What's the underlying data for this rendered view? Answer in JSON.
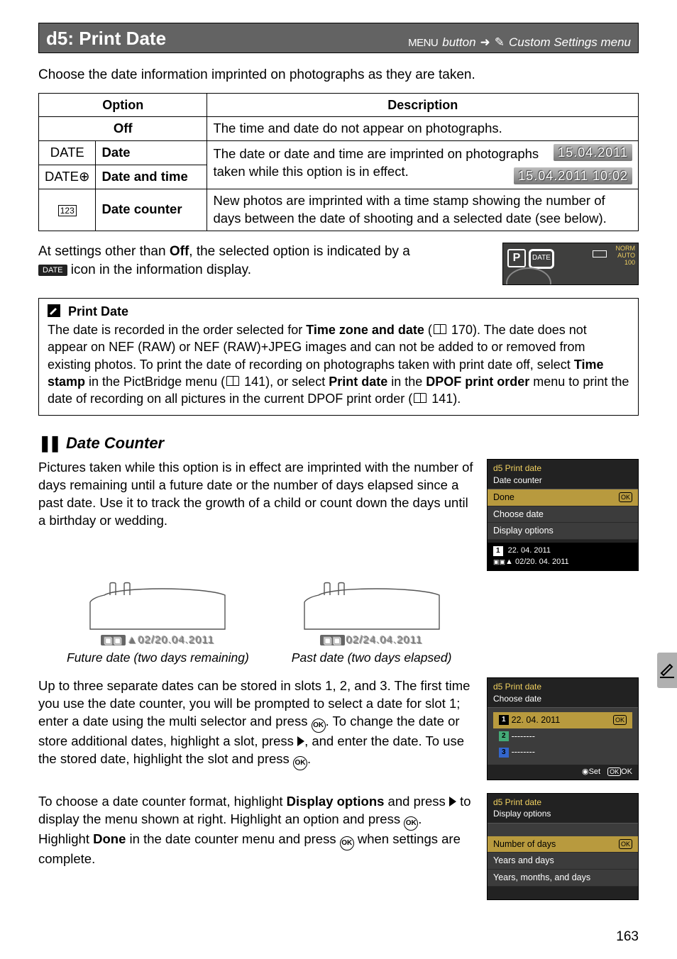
{
  "header": {
    "title": "d5: Print Date",
    "menu_label": "MENU",
    "button_text": "button",
    "arrow": "➜",
    "pencil": "✎",
    "crumb": "Custom Settings menu"
  },
  "intro": "Choose the date information imprinted on photographs as they are taken.",
  "table": {
    "col_option": "Option",
    "col_desc": "Description",
    "rows": {
      "off": {
        "icon": "",
        "label": "Off",
        "desc": "The time and date do not appear on photographs."
      },
      "date": {
        "icon": "DATE",
        "label": "Date",
        "desc": "The date or date and time are imprinted on photographs taken while this option is in effect.",
        "badge": "15.04.2011"
      },
      "datetime": {
        "icon": "DATE⊕",
        "label": "Date and time",
        "badge": "15.04.2011 10:02"
      },
      "counter": {
        "icon": "123",
        "label": "Date counter",
        "desc": "New photos are imprinted with a time stamp showing the number of days between the date of shooting and a selected date (see below)."
      }
    }
  },
  "post_table": {
    "l1a": "At settings other than ",
    "off": "Off",
    "l1b": ", the selected option is indicated by a ",
    "l2a": " icon in the information display.",
    "chip": "DATE",
    "lcd": {
      "P": "P",
      "norm": "NORM\nAUTO\n100"
    }
  },
  "note": {
    "title": "Print Date",
    "b1": "The date is recorded in the order selected for ",
    "tz": "Time zone and date",
    "b2": " (",
    "p1": "170).  The date does not appear on NEF (RAW) or NEF (RAW)+JPEG images and can not be added to or removed from existing photos.  To print the date of recording on photographs taken with print date off, select ",
    "ts": "Time stamp",
    "b3": " in the PictBridge menu (",
    "p2": "141), or select ",
    "pd": "Print date",
    "b4": " in the ",
    "dp": "DPOF print order",
    "b5": " menu to print the date of recording on all pictures in the current DPOF print order (",
    "p3": "141)."
  },
  "section_title": "Date Counter",
  "dc_par": "Pictures taken while this option is in effect are imprinted with the number of days remaining until a future date or the number of days elapsed since a past date. Use it to track the growth of a child or count down the days until a birthday or wedding.",
  "screen1": {
    "label": "d5 Print date",
    "sub": "Date counter",
    "items": [
      "Done",
      "Choose date",
      "Display options"
    ],
    "ok": "OK",
    "slot1": "1",
    "d1": "22. 04. 2011",
    "d2": "02/20. 04. 2011"
  },
  "photos": {
    "left_badge": "▲02/20.04.2011",
    "left_cap": "Future date (two days remaining)",
    "right_badge": "02/24.04.2011",
    "right_cap": "Past date (two days elapsed)"
  },
  "par2": {
    "a": "Up to three separate dates can be stored in slots 1, 2, and 3.  The first time you use the date counter, you will be prompted to select a date for slot 1; enter a date using the multi selector and press ",
    "b": ".  To change the date or store additional dates, highlight a slot, press ",
    "c": ", and enter the date.  To use the stored date, highlight the slot and press ",
    "d": "."
  },
  "screen2": {
    "label": "d5 Print date",
    "sub": "Choose date",
    "slot1": "1",
    "slot2": "2",
    "slot3": "3",
    "d1": "22. 04. 2011",
    "dash": "--------",
    "ok": "OK",
    "set": "Set",
    "okf": "OK"
  },
  "par3": {
    "a": "To choose a date counter format, highlight ",
    "disp": "Display options",
    "b": " and press ",
    "c": " to display the menu shown at right.  Highlight an option and press ",
    "d": ".  Highlight ",
    "done": "Done",
    "e": " in the date counter menu and press ",
    "f": " when settings are complete."
  },
  "screen3": {
    "label": "d5 Print date",
    "sub": "Display options",
    "items": [
      "Number of days",
      "Years and days",
      "Years, months, and days"
    ],
    "ok": "OK"
  },
  "page_num": "163"
}
